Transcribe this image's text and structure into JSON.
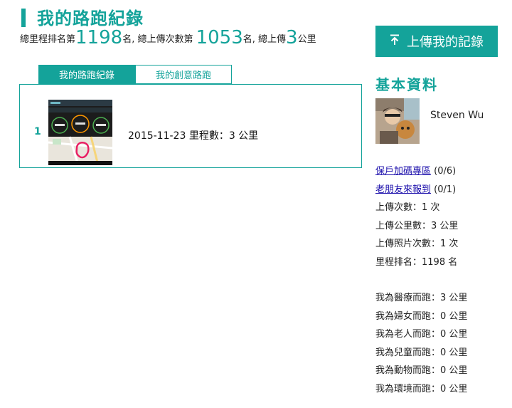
{
  "header": {
    "title": "我的路跑紀錄",
    "stats": {
      "prefix": "總里程排名第",
      "rank": "1198",
      "mid1": "名, 總上傳次數第",
      "upload_rank": "1053",
      "mid2": "名, 總上傳",
      "km": "3",
      "suffix": "公里"
    },
    "upload_button": "上傳我的記錄",
    "upload_icon": "up-arrow-icon"
  },
  "tabs": [
    {
      "label": "我的路跑紀錄",
      "active": true
    },
    {
      "label": "我的創意路跑",
      "active": false
    }
  ],
  "records": [
    {
      "index": "1",
      "date": "2015-11-23",
      "distance_label": "里程數：",
      "distance": "3 公里"
    }
  ],
  "sidebar": {
    "heading": "基本資料",
    "user_name": "Steven Wu",
    "links": [
      {
        "label": "保戶加碼專區",
        "count": " (0/6)"
      },
      {
        "label": "老朋友來報到",
        "count": " (0/1)"
      }
    ],
    "stats": [
      "上傳次數：1 次",
      "上傳公里數：3 公里",
      "上傳照片次數：1 次",
      "里程排名：1198 名"
    ],
    "causes": [
      "我為醫療而跑：3 公里",
      "我為婦女而跑：0 公里",
      "我為老人而跑：0 公里",
      "我為兒童而跑：0 公里",
      "我為動物而跑：0 公里",
      "我為環境而跑：0 公里"
    ]
  },
  "colors": {
    "accent": "#14a39a",
    "link": "#1a0dab"
  }
}
